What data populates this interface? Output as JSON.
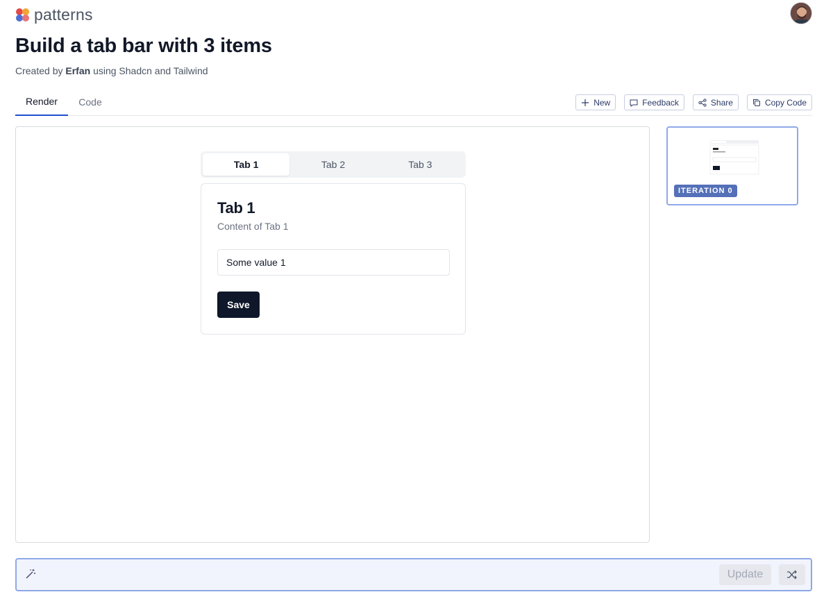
{
  "header": {
    "brand": "patterns",
    "title": "Build a tab bar with 3 items",
    "byline_prefix": "Created by",
    "author": "Erfan",
    "byline_suffix": "using Shadcn and Tailwind"
  },
  "view_tabs": {
    "render": "Render",
    "code": "Code",
    "active": "Render"
  },
  "actions": {
    "new": "New",
    "feedback": "Feedback",
    "share": "Share",
    "copy_code": "Copy Code"
  },
  "preview": {
    "tabs": [
      {
        "label": "Tab 1",
        "active": true
      },
      {
        "label": "Tab 2",
        "active": false
      },
      {
        "label": "Tab 3",
        "active": false
      }
    ],
    "card": {
      "title": "Tab 1",
      "description": "Content of Tab 1",
      "input_value": "Some value 1",
      "save_label": "Save"
    }
  },
  "iteration": {
    "label": "ITERATION 0"
  },
  "prompt": {
    "placeholder": "",
    "update_label": "Update"
  },
  "icons": {
    "new": "plus-icon",
    "feedback": "message-icon",
    "share": "share-icon",
    "copy_code": "copy-icon",
    "prompt": "magic-wand-icon",
    "shuffle": "shuffle-icon"
  },
  "colors": {
    "accent": "#1f4fd1",
    "iteration_badge": "#5470b9",
    "save_button": "#0f172a",
    "prompt_border": "#8ea8e8"
  }
}
